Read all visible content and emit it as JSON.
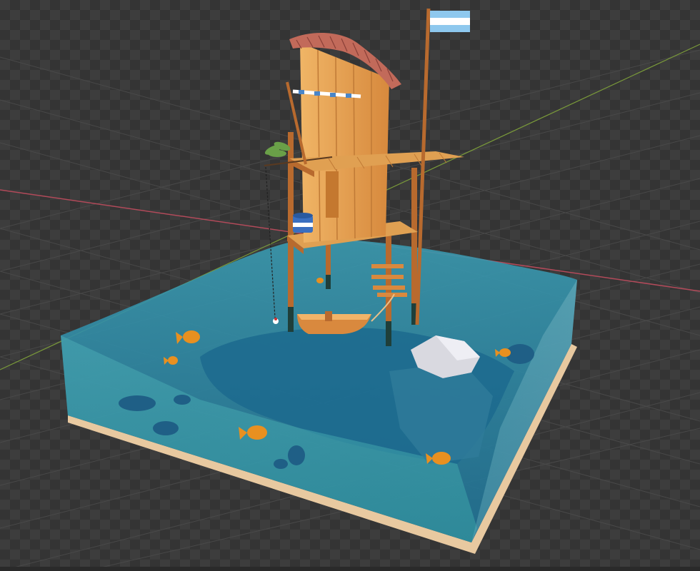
{
  "viewport": {
    "mode": "3d-viewport",
    "background": "#3d3d3d",
    "checker": "#343434",
    "grid_color": "#555555",
    "x_axis_color": "#b24a5a",
    "y_axis_color": "#7a9a3a"
  },
  "scene": {
    "objects": [
      "stilt-house",
      "flag",
      "fishing-pole",
      "bucket",
      "plant",
      "rowboat",
      "ladder",
      "rock",
      "water-volume",
      "sand-base",
      "fish",
      "stones"
    ],
    "colors": {
      "wood_light": "#e9a857",
      "wood_dark": "#b86a2e",
      "roof": "#c26a5a",
      "water": "#2c8aa0",
      "water_deep": "#1e5f80",
      "sand": "#e8c9a0",
      "fish": "#e89020",
      "rock": "#d9d9e0",
      "flag_blue": "#8ec8ee",
      "flag_white": "#ffffff",
      "bucket": "#3a6fc0",
      "plant": "#6aa048"
    },
    "fish_count": 6
  }
}
